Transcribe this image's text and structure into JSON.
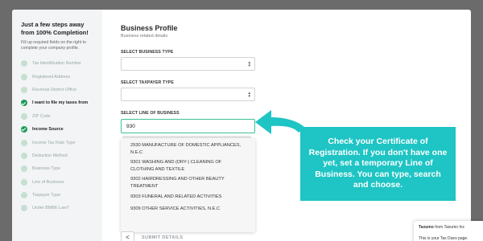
{
  "sidebar": {
    "title": "Just a few steps away from 100% Completion!",
    "subtitle": "Fill up required fields on the right to complete your company profile.",
    "steps": [
      {
        "label": "Tax Identification Number",
        "done": false
      },
      {
        "label": "Registered Address",
        "done": false
      },
      {
        "label": "Revenue District Office",
        "done": false
      },
      {
        "label": "I want to file my taxes from",
        "done": true
      },
      {
        "label": "ZIP Code",
        "done": false
      },
      {
        "label": "Income Source",
        "done": true
      },
      {
        "label": "Income Tax Rate Type",
        "done": false
      },
      {
        "label": "Deduction Method",
        "done": false
      },
      {
        "label": "Business Type",
        "done": false
      },
      {
        "label": "Line of Business",
        "done": false
      },
      {
        "label": "Taxpayer Type",
        "done": false
      },
      {
        "label": "Under BMBE Law?",
        "done": false
      }
    ]
  },
  "form": {
    "title": "Business Profile",
    "subtitle": "Business related details",
    "business_type_label": "SELECT BUSINESS TYPE",
    "taxpayer_type_label": "SELECT TAXPAYER TYPE",
    "line_of_business_label": "SELECT LINE OF BUSINESS",
    "line_of_business_value": "930",
    "submit_label": "SUBMIT DETAILS",
    "back_label": "<"
  },
  "dropdown": {
    "options": [
      "2930 Manufacture of domestic appliances, N.E.C",
      "9301 Washing and (dry-) cleaning of clothing and textile",
      "9302 Hairdressing and other beauty treatment",
      "9303 Funeral and related activities",
      "9309 Other service activities, N.E.C"
    ]
  },
  "callout": {
    "text": "Check your Certificate of Registration. If you don't have one yet, set a temporary Line of Business. You can type, search and choose.",
    "color": "#1fc4c4"
  },
  "toast": {
    "sender": "Taxumo",
    "from_suffix": "from Taxumo Inc",
    "message": "This is your Tax Dues page."
  },
  "colors": {
    "accent_green": "#1c9c59",
    "input_focus": "#3fc199",
    "background": "#6b6b6b"
  }
}
